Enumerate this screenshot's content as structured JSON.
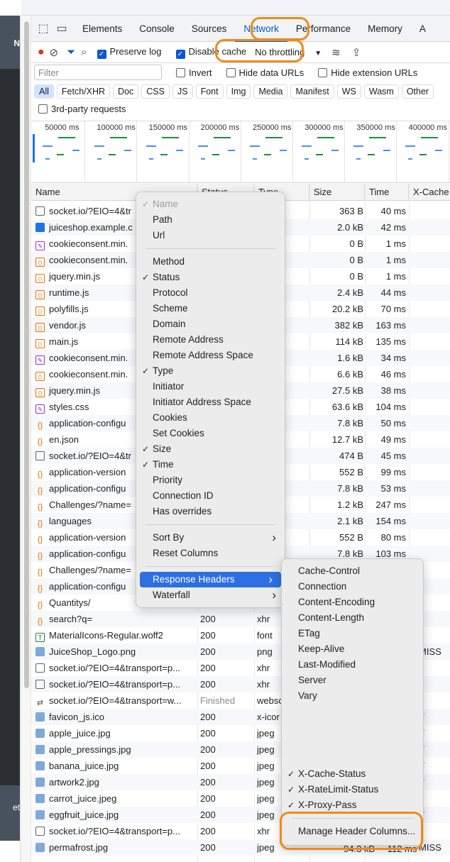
{
  "tabs": [
    "Elements",
    "Console",
    "Sources",
    "Network",
    "Performance",
    "Memory",
    "A"
  ],
  "active_tab": "Network",
  "toolbar": {
    "preserve_log": "Preserve log",
    "disable_cache": "Disable cache",
    "throttling": "No throttling"
  },
  "filter": {
    "placeholder": "Filter",
    "invert": "Invert",
    "hide_data_urls": "Hide data URLs",
    "hide_extension_urls": "Hide extension URLs"
  },
  "type_filters": [
    "All",
    "Fetch/XHR",
    "Doc",
    "CSS",
    "JS",
    "Font",
    "Img",
    "Media",
    "Manifest",
    "WS",
    "Wasm",
    "Other"
  ],
  "third_party": "3rd-party requests",
  "timeline_labels": [
    "50000 ms",
    "100000 ms",
    "150000 ms",
    "200000 ms",
    "250000 ms",
    "300000 ms",
    "350000 ms",
    "400000 ms"
  ],
  "columns": {
    "name": "Name",
    "status": "Status",
    "type": "Type",
    "size": "Size",
    "time": "Time",
    "xcache": "X-Cache"
  },
  "rows": [
    {
      "name": "socket.io/?EIO=4&tr",
      "status": "",
      "type": "",
      "size": "363 B",
      "time": "40 ms",
      "xcache": "",
      "icon": "doc"
    },
    {
      "name": "juiceshop.example.c",
      "status": "",
      "type": "ment",
      "size": "2.0 kB",
      "time": "42 ms",
      "xcache": "",
      "icon": "html"
    },
    {
      "name": "cookieconsent.min.",
      "status": "",
      "type": "he...",
      "size": "0 B",
      "time": "1 ms",
      "xcache": "",
      "icon": "css"
    },
    {
      "name": "cookieconsent.min.",
      "status": "",
      "type": "/ R...",
      "size": "0 B",
      "time": "1 ms",
      "xcache": "",
      "icon": "js"
    },
    {
      "name": "jquery.min.js",
      "status": "",
      "type": "/ R...",
      "size": "0 B",
      "time": "1 ms",
      "xcache": "",
      "icon": "js"
    },
    {
      "name": "runtime.js",
      "status": "",
      "type": "",
      "size": "2.4 kB",
      "time": "44 ms",
      "xcache": "",
      "icon": "js"
    },
    {
      "name": "polyfills.js",
      "status": "",
      "type": "",
      "size": "20.2 kB",
      "time": "70 ms",
      "xcache": "",
      "icon": "js"
    },
    {
      "name": "vendor.js",
      "status": "",
      "type": "",
      "size": "382 kB",
      "time": "163 ms",
      "xcache": "",
      "icon": "js"
    },
    {
      "name": "main.js",
      "status": "",
      "type": "",
      "size": "114 kB",
      "time": "135 ms",
      "xcache": "",
      "icon": "js"
    },
    {
      "name": "cookieconsent.min.",
      "status": "",
      "type": "heet",
      "size": "1.6 kB",
      "time": "34 ms",
      "xcache": "",
      "icon": "css"
    },
    {
      "name": "cookieconsent.min.",
      "status": "",
      "type": "",
      "size": "6.6 kB",
      "time": "46 ms",
      "xcache": "",
      "icon": "js"
    },
    {
      "name": "jquery.min.js",
      "status": "",
      "type": "",
      "size": "27.5 kB",
      "time": "38 ms",
      "xcache": "",
      "icon": "js"
    },
    {
      "name": "styles.css",
      "status": "",
      "type": "heet",
      "size": "63.6 kB",
      "time": "104 ms",
      "xcache": "",
      "icon": "css"
    },
    {
      "name": "application-configu",
      "status": "",
      "type": "",
      "size": "7.8 kB",
      "time": "50 ms",
      "xcache": "",
      "icon": "json"
    },
    {
      "name": "en.json",
      "status": "",
      "type": "",
      "size": "12.7 kB",
      "time": "49 ms",
      "xcache": "",
      "icon": "json"
    },
    {
      "name": "socket.io/?EIO=4&tr",
      "status": "",
      "type": "",
      "size": "474 B",
      "time": "45 ms",
      "xcache": "",
      "icon": "doc"
    },
    {
      "name": "application-version",
      "status": "",
      "type": "",
      "size": "552 B",
      "time": "99 ms",
      "xcache": "",
      "icon": "json"
    },
    {
      "name": "application-configu",
      "status": "",
      "type": "",
      "size": "7.8 kB",
      "time": "53 ms",
      "xcache": "",
      "icon": "json"
    },
    {
      "name": "Challenges/?name=",
      "status": "",
      "type": "",
      "size": "1.2 kB",
      "time": "247 ms",
      "xcache": "",
      "icon": "json"
    },
    {
      "name": "languages",
      "status": "",
      "type": "",
      "size": "2.1 kB",
      "time": "154 ms",
      "xcache": "",
      "icon": "json"
    },
    {
      "name": "application-version",
      "status": "",
      "type": "",
      "size": "552 B",
      "time": "80 ms",
      "xcache": "",
      "icon": "json"
    },
    {
      "name": "application-configu",
      "status": "",
      "type": "",
      "size": "7.8 kB",
      "time": "103 ms",
      "xcache": "",
      "icon": "json"
    },
    {
      "name": "Challenges/?name=",
      "status": "",
      "type": "",
      "size": "",
      "time": "",
      "xcache": "",
      "icon": "json"
    },
    {
      "name": "application-configu",
      "status": "",
      "type": "",
      "size": "",
      "time": "",
      "xcache": "",
      "icon": "json"
    },
    {
      "name": "Quantitys/",
      "status": "200",
      "type": "xhr",
      "size": "",
      "time": "",
      "xcache": "",
      "icon": "json"
    },
    {
      "name": "search?q=",
      "status": "200",
      "type": "xhr",
      "size": "",
      "time": "",
      "xcache": "",
      "icon": "json"
    },
    {
      "name": "MaterialIcons-Regular.woff2",
      "status": "200",
      "type": "font",
      "size": "",
      "time": "",
      "xcache": "",
      "icon": "font"
    },
    {
      "name": "JuiceShop_Logo.png",
      "status": "200",
      "type": "png",
      "size": "",
      "time": "",
      "xcache": "MISS",
      "icon": "img"
    },
    {
      "name": "socket.io/?EIO=4&transport=p...",
      "status": "200",
      "type": "xhr",
      "size": "",
      "time": "",
      "xcache": "",
      "icon": "doc"
    },
    {
      "name": "socket.io/?EIO=4&transport=p...",
      "status": "200",
      "type": "xhr",
      "size": "",
      "time": "",
      "xcache": "",
      "icon": "doc"
    },
    {
      "name": "socket.io/?EIO=4&transport=w...",
      "status": "Finished",
      "type": "webso",
      "size": "",
      "time": "",
      "xcache": "",
      "icon": "ws"
    },
    {
      "name": "favicon_js.ico",
      "status": "200",
      "type": "x-icor",
      "size": "",
      "time": "",
      "xcache": "T",
      "icon": "img"
    },
    {
      "name": "apple_juice.jpg",
      "status": "200",
      "type": "jpeg",
      "size": "",
      "time": "",
      "xcache": "T",
      "icon": "img"
    },
    {
      "name": "apple_pressings.jpg",
      "status": "200",
      "type": "jpeg",
      "size": "",
      "time": "",
      "xcache": "T",
      "icon": "img"
    },
    {
      "name": "banana_juice.jpg",
      "status": "200",
      "type": "jpeg",
      "size": "",
      "time": "",
      "xcache": "T",
      "icon": "img"
    },
    {
      "name": "artwork2.jpg",
      "status": "200",
      "type": "jpeg",
      "size": "",
      "time": "",
      "xcache": "T",
      "icon": "img"
    },
    {
      "name": "carrot_juice.jpeg",
      "status": "200",
      "type": "jpeg",
      "size": "",
      "time": "",
      "xcache": "",
      "icon": "img"
    },
    {
      "name": "eggfruit_juice.jpg",
      "status": "200",
      "type": "jpeg",
      "size": "",
      "time": "",
      "xcache": "T",
      "icon": "img"
    },
    {
      "name": "socket.io/?EIO=4&transport=p...",
      "status": "200",
      "type": "xhr",
      "size": "",
      "time": "",
      "xcache": "",
      "icon": "doc"
    },
    {
      "name": "permafrost.jpg",
      "status": "200",
      "type": "jpeg",
      "size": "",
      "time": "",
      "xcache": "MISS",
      "icon": "img"
    }
  ],
  "context_menu": [
    {
      "label": "Name",
      "checked": true,
      "disabled": true
    },
    {
      "label": "Path",
      "checked": false
    },
    {
      "label": "Url",
      "checked": false
    },
    {
      "sep": true
    },
    {
      "label": "Method",
      "checked": false
    },
    {
      "label": "Status",
      "checked": true
    },
    {
      "label": "Protocol",
      "checked": false
    },
    {
      "label": "Scheme",
      "checked": false
    },
    {
      "label": "Domain",
      "checked": false
    },
    {
      "label": "Remote Address",
      "checked": false
    },
    {
      "label": "Remote Address Space",
      "checked": false
    },
    {
      "label": "Type",
      "checked": true
    },
    {
      "label": "Initiator",
      "checked": false
    },
    {
      "label": "Initiator Address Space",
      "checked": false
    },
    {
      "label": "Cookies",
      "checked": false
    },
    {
      "label": "Set Cookies",
      "checked": false
    },
    {
      "label": "Size",
      "checked": true
    },
    {
      "label": "Time",
      "checked": true
    },
    {
      "label": "Priority",
      "checked": false
    },
    {
      "label": "Connection ID",
      "checked": false
    },
    {
      "label": "Has overrides",
      "checked": false
    },
    {
      "sep": true
    },
    {
      "label": "Sort By",
      "submenu": true
    },
    {
      "label": "Reset Columns"
    },
    {
      "sep": true
    },
    {
      "label": "Response Headers",
      "submenu": true,
      "selected": true
    },
    {
      "label": "Waterfall",
      "submenu": true
    }
  ],
  "submenu": [
    {
      "label": "Cache-Control",
      "checked": false
    },
    {
      "label": "Connection",
      "checked": false
    },
    {
      "label": "Content-Encoding",
      "checked": false
    },
    {
      "label": "Content-Length",
      "checked": false
    },
    {
      "label": "ETag",
      "checked": false
    },
    {
      "label": "Keep-Alive",
      "checked": false
    },
    {
      "label": "Last-Modified",
      "checked": false
    },
    {
      "label": "Server",
      "checked": false
    },
    {
      "label": "Vary",
      "checked": false
    },
    {
      "gap": true
    },
    {
      "label": "X-Cache-Status",
      "checked": true
    },
    {
      "label": "X-RateLimit-Status",
      "checked": true
    },
    {
      "label": "X-Proxy-Pass",
      "checked": true
    },
    {
      "sep": true
    },
    {
      "label": "Manage Header Columns..."
    }
  ],
  "left_panel": {
    "top_label": "N",
    "bottom_label": "et"
  },
  "partial_bottom": {
    "size": "94.3 kB",
    "time": "112 ms"
  },
  "colors": {
    "accent": "#0b57d0",
    "highlight": "#ef8a1a",
    "menu_selected": "#2d6fe0"
  }
}
